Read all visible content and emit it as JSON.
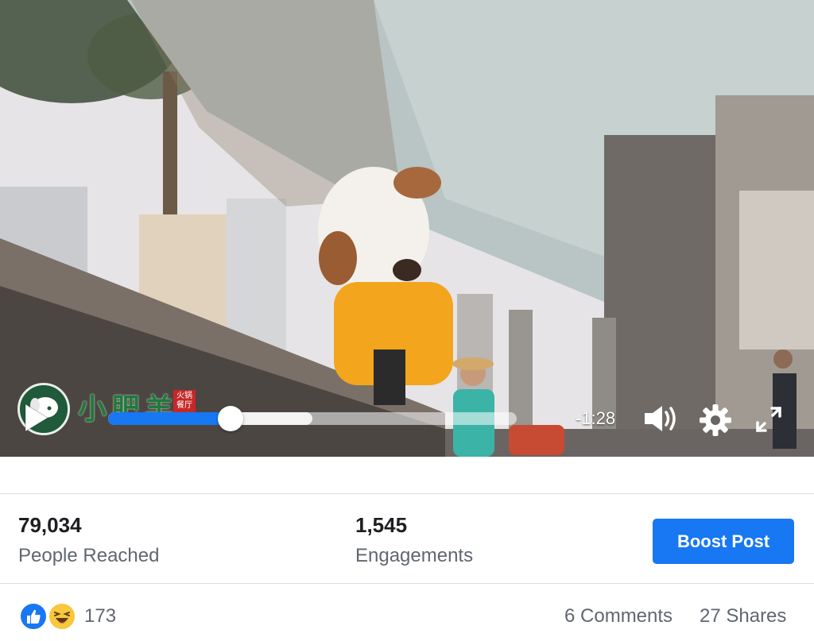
{
  "video": {
    "brand_name": "小肥羊",
    "brand_tag": "火锅餐厅",
    "time_remaining": "-1:28",
    "progress_played": 0.3,
    "progress_buffered": 0.5
  },
  "stats": {
    "people_reached_value": "79,034",
    "people_reached_label": "People Reached",
    "engagements_value": "1,545",
    "engagements_label": "Engagements",
    "boost_label": "Boost Post"
  },
  "reactions": {
    "count": "173",
    "comments": "6 Comments",
    "shares": "27 Shares"
  },
  "colors": {
    "accent": "#1877f2",
    "text_secondary": "#606770",
    "text_primary": "#1c1e21"
  },
  "icons": [
    "play-icon",
    "volume-icon",
    "gear-icon",
    "fullscreen-icon",
    "like-icon",
    "haha-icon"
  ]
}
